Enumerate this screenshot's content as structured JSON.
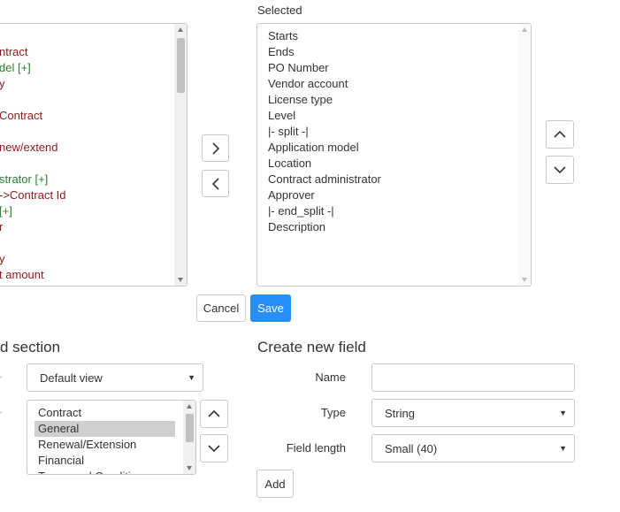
{
  "selected_header": "Selected",
  "available_list": {
    "items": [
      {
        "text": "ntract",
        "color": "red"
      },
      {
        "text": "del [+]",
        "color": "green"
      },
      {
        "text": "y",
        "color": "red"
      },
      {
        "text": "",
        "color": "norm"
      },
      {
        "text": "Contract",
        "color": "red"
      },
      {
        "text": "",
        "color": "norm"
      },
      {
        "text": "new/extend",
        "color": "red"
      },
      {
        "text": "",
        "color": "norm"
      },
      {
        "text": "strator [+]",
        "color": "green"
      },
      {
        "text": "->Contract Id",
        "color": "red"
      },
      {
        "text": "[+]",
        "color": "green"
      },
      {
        "text": "r",
        "color": "red"
      },
      {
        "text": "",
        "color": "norm"
      },
      {
        "text": "y",
        "color": "red"
      },
      {
        "text": "t amount",
        "color": "red"
      }
    ]
  },
  "selected_list": {
    "items": [
      "Starts",
      "Ends",
      "PO Number",
      "Vendor account",
      "License type",
      "Level",
      "|- split -|",
      "Application model",
      "Location",
      "Contract administrator",
      "Approver",
      "|- end_split -|",
      "Description"
    ]
  },
  "actions": {
    "cancel": "Cancel",
    "save": "Save"
  },
  "section_panel": {
    "title": "d section",
    "view_select": "Default view",
    "sections": [
      "Contract",
      "General",
      "Renewal/Extension",
      "Financial",
      "Terms and Conditions"
    ],
    "selected_index": 1
  },
  "create_field": {
    "title": "Create new field",
    "name_label": "Name",
    "name_value": "",
    "type_label": "Type",
    "type_value": "String",
    "length_label": "Field length",
    "length_value": "Small (40)",
    "add_label": "Add"
  },
  "colors": {
    "primary": "#278efc",
    "red": "#8b1b1b",
    "green": "#2b7d2b",
    "highlight": "#cfcfcf"
  }
}
